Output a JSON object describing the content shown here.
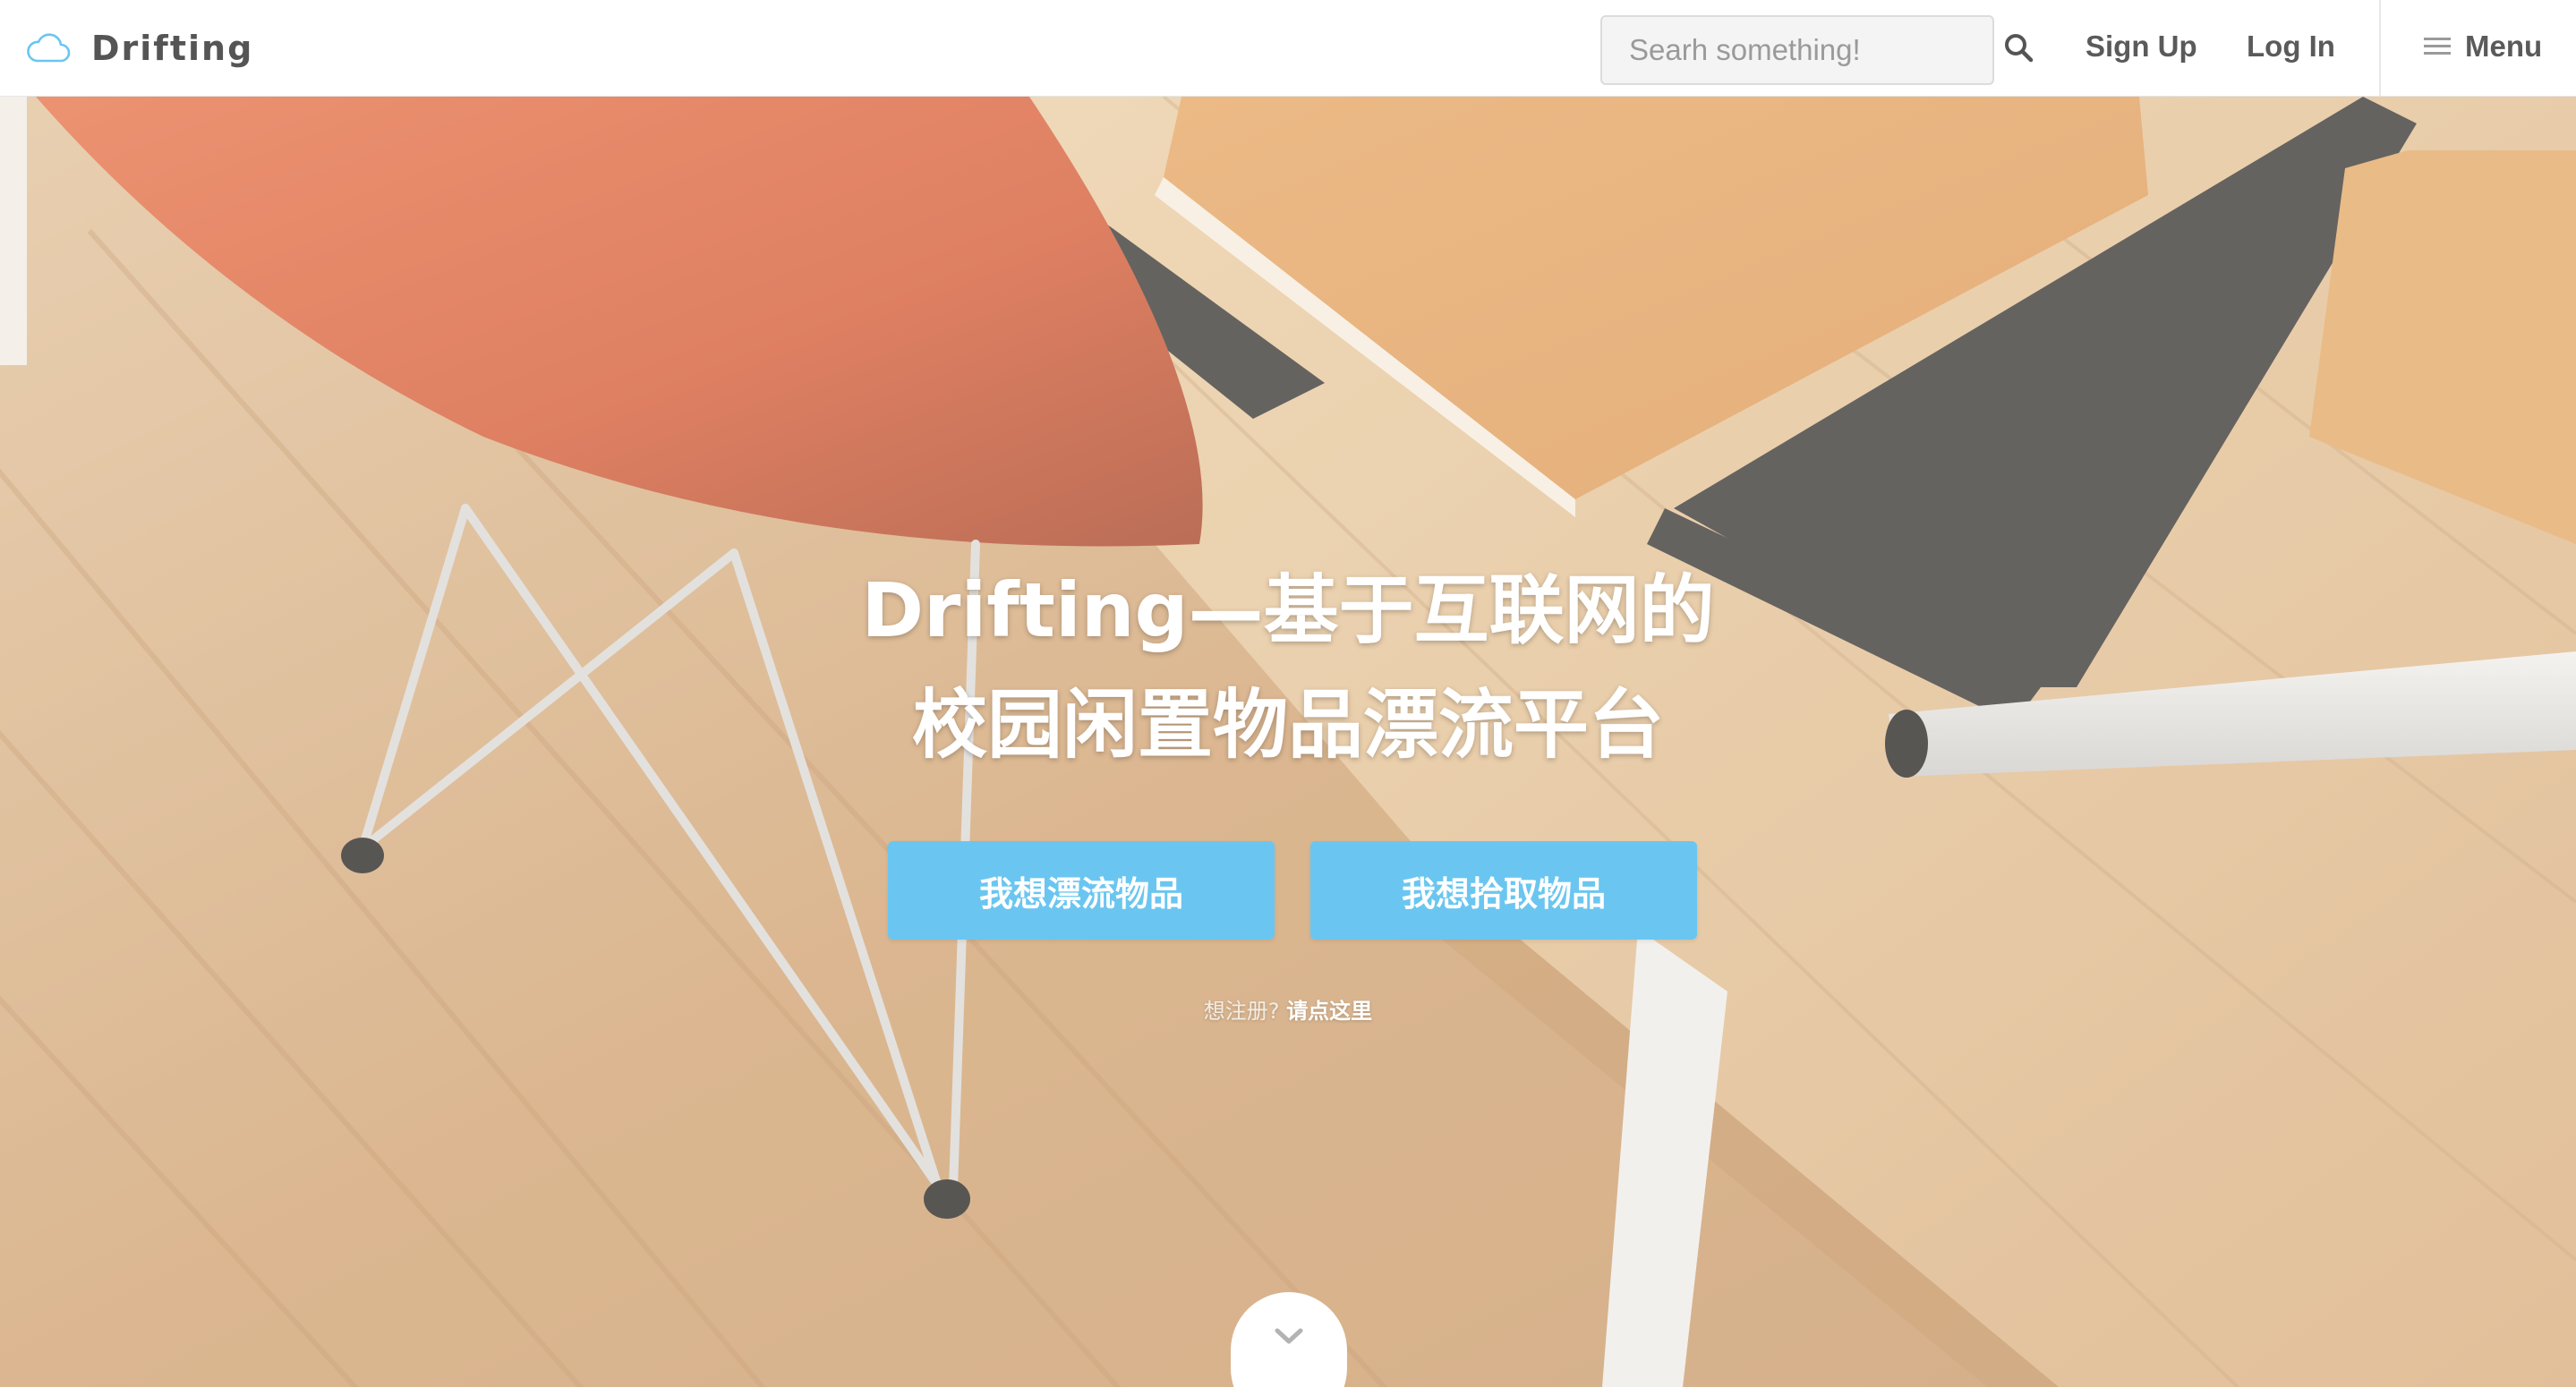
{
  "header": {
    "brand_name": "Drifting",
    "logo_icon": "cloud-icon",
    "search_placeholder": "Searh something!",
    "search_icon": "search-icon",
    "signup_label": "Sign Up",
    "login_label": "Log In",
    "menu_label": "Menu",
    "menu_icon": "hamburger-icon"
  },
  "hero": {
    "title_line1": "Drifting—基于互联网的",
    "title_line2": "校园闲置物品漂流平台",
    "drift_button_label": "我想漂流物品",
    "pick_button_label": "我想拾取物品",
    "register_prompt": "想注册?",
    "register_link": "请点这里",
    "scroll_icon": "chevron-down-icon"
  },
  "colors": {
    "accent": "#6ac6f0",
    "nav_text": "#5a5a5a",
    "cloud_icon": "#6ac6f0"
  }
}
